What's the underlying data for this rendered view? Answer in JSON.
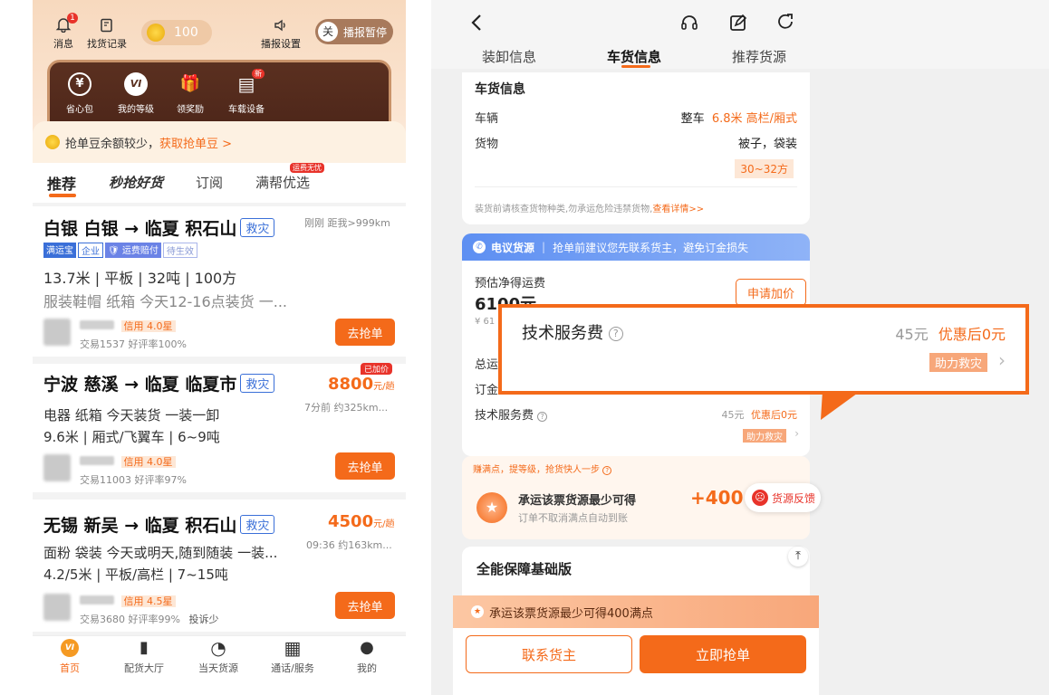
{
  "left": {
    "top_bar": {
      "notif_label": "消息",
      "notif_badge": "1",
      "find_cargo_label": "找货记录",
      "coin_value": "100",
      "broadcast_settings_label": "播报设置",
      "broadcast_toggle_key": "关",
      "broadcast_status": "播报暂停"
    },
    "feature_panel": {
      "items": [
        {
          "label": "省心包",
          "glyph": "¥"
        },
        {
          "label": "我的等级",
          "glyph": "VI"
        },
        {
          "label": "领奖励",
          "glyph": "🎁"
        },
        {
          "label": "车载设备",
          "glyph": "▤",
          "badge": "新"
        }
      ]
    },
    "notice": {
      "text": "抢单豆余额较少，",
      "link": "获取抢单豆 >"
    },
    "tabs": {
      "recommend": "推荐",
      "grab": "秒抢好货",
      "subscribe": "订阅",
      "preferred": "满帮优选",
      "preferred_badge": "运费无忧"
    },
    "cards": [
      {
        "route": "白银 白银 → 临夏 积石山",
        "tag": "救灾",
        "meta": "刚刚 距我>999km",
        "badges": {
          "pay": "满运宝",
          "corp": "企业",
          "compensation": "运费赔付",
          "pending": "待生效"
        },
        "spec": "13.7米 | 平板 | 32吨 | 100方",
        "desc": "服装鞋帽 纸箱 今天12-16点装货 一...",
        "credit": "信用 4.0星",
        "stats": "交易1537 好评率100%",
        "action": "去抢单"
      },
      {
        "route": "宁波 慈溪 → 临夏 临夏市",
        "tag": "救灾",
        "price_badge": "已加价",
        "price": "8800",
        "unit": "元/趟",
        "meta": "7分前 约325km...",
        "desc": "电器 纸箱 今天装货 一装一卸",
        "spec": "9.6米 | 厢式/飞翼车 | 6~9吨",
        "credit": "信用 4.0星",
        "stats": "交易11003 好评率97%",
        "action": "去抢单"
      },
      {
        "route": "无锡 新吴 → 临夏 积石山",
        "tag": "救灾",
        "price": "4500",
        "unit": "元/趟",
        "meta": "09:36 约163km...",
        "desc": "面粉 袋装 今天或明天,随到随装 一装...",
        "spec": "4.2/5米 | 平板/高栏 | 7~15吨",
        "credit": "信用 4.5星",
        "stats": "交易3680 好评率99%",
        "complaint": "投诉少",
        "action": "去抢单"
      }
    ],
    "bottom_nav": [
      {
        "label": "首页",
        "icon": "vi-icon",
        "glyph": "VI"
      },
      {
        "label": "配货大厅",
        "icon": "book-icon",
        "glyph": "▮"
      },
      {
        "label": "当天货源",
        "icon": "clock-icon",
        "glyph": "◔"
      },
      {
        "label": "通话/服务",
        "icon": "grid-icon",
        "glyph": "▦"
      },
      {
        "label": "我的",
        "icon": "user-icon",
        "glyph": "●"
      }
    ]
  },
  "right": {
    "header": {
      "back_icon": "chevron-left-icon",
      "service_icon": "headset-icon",
      "edit_icon": "edit-icon",
      "share_icon": "share-icon"
    },
    "tabs": [
      "装卸信息",
      "车货信息",
      "推荐货源"
    ],
    "cargo_info": {
      "title": "车货信息",
      "vehicle_label": "车辆",
      "vehicle_type": "整车",
      "vehicle_spec": "6.8米 高栏/厢式",
      "goods_label": "货物",
      "goods_value": "被子，袋装",
      "volume": "30~32方",
      "notice": "装货前请核查货物种类,勿承运危险违禁货物,",
      "notice_link": "查看详情>>"
    },
    "negotiable": {
      "title": "电议货源",
      "text": "抢单前建议您先联系货主，避免订金损失"
    },
    "freight": {
      "estimate_label": "预估净得运费",
      "estimate_value": "6100元",
      "sub": "¥ 61",
      "raise_button": "申请加价",
      "total_label": "总运",
      "deposit_label": "订金",
      "fee_label": "技术服务费",
      "fee_original": "45元",
      "fee_discount": "优惠后",
      "fee_discount_value": "0元",
      "fee_tag": "助力救灾"
    },
    "callout": {
      "fee_label": "技术服务费",
      "fee_original": "45元",
      "fee_discount": "优惠后",
      "fee_discount_value": "0元",
      "fee_tag": "助力救灾"
    },
    "points": {
      "banner": "赚满点，提等级，抢货快人一步",
      "title": "承运该票货源最少可得",
      "sub": "订单不取消满点自动到账",
      "value": "+400",
      "feedback": "货源反馈"
    },
    "guarantee": {
      "title": "全能保障基础版"
    },
    "bottom_strip": {
      "text": "承运该票货源最少可得400满点"
    },
    "actions": {
      "contact": "联系货主",
      "grab": "立即抢单"
    }
  }
}
